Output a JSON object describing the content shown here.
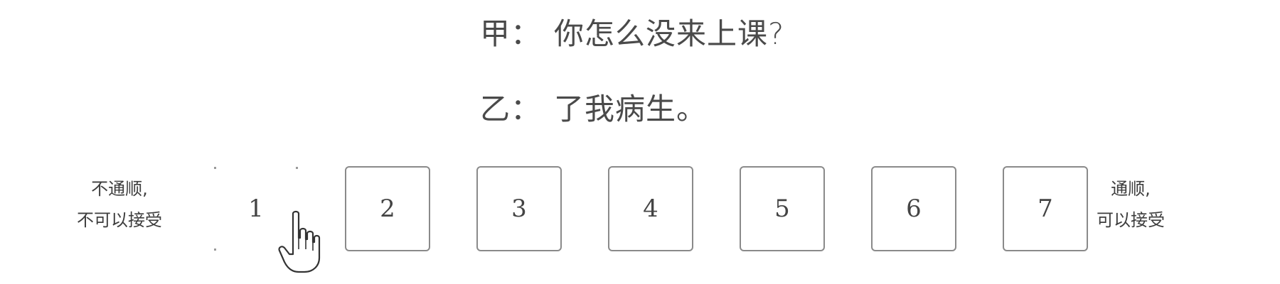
{
  "dialog": {
    "line_a": {
      "speaker": "甲：",
      "text": "你怎么没来上课?"
    },
    "line_b": {
      "speaker": "乙：",
      "text": "了我病生。"
    }
  },
  "scale": {
    "left_anchor": {
      "line1": "不通顺,",
      "line2": "不可以接受"
    },
    "right_anchor": {
      "line1": "通顺,",
      "line2": "可以接受"
    },
    "options": [
      "1",
      "2",
      "3",
      "4",
      "5",
      "6",
      "7"
    ],
    "selected": "1"
  },
  "icons": {
    "cursor": "hand-pointer-icon"
  }
}
